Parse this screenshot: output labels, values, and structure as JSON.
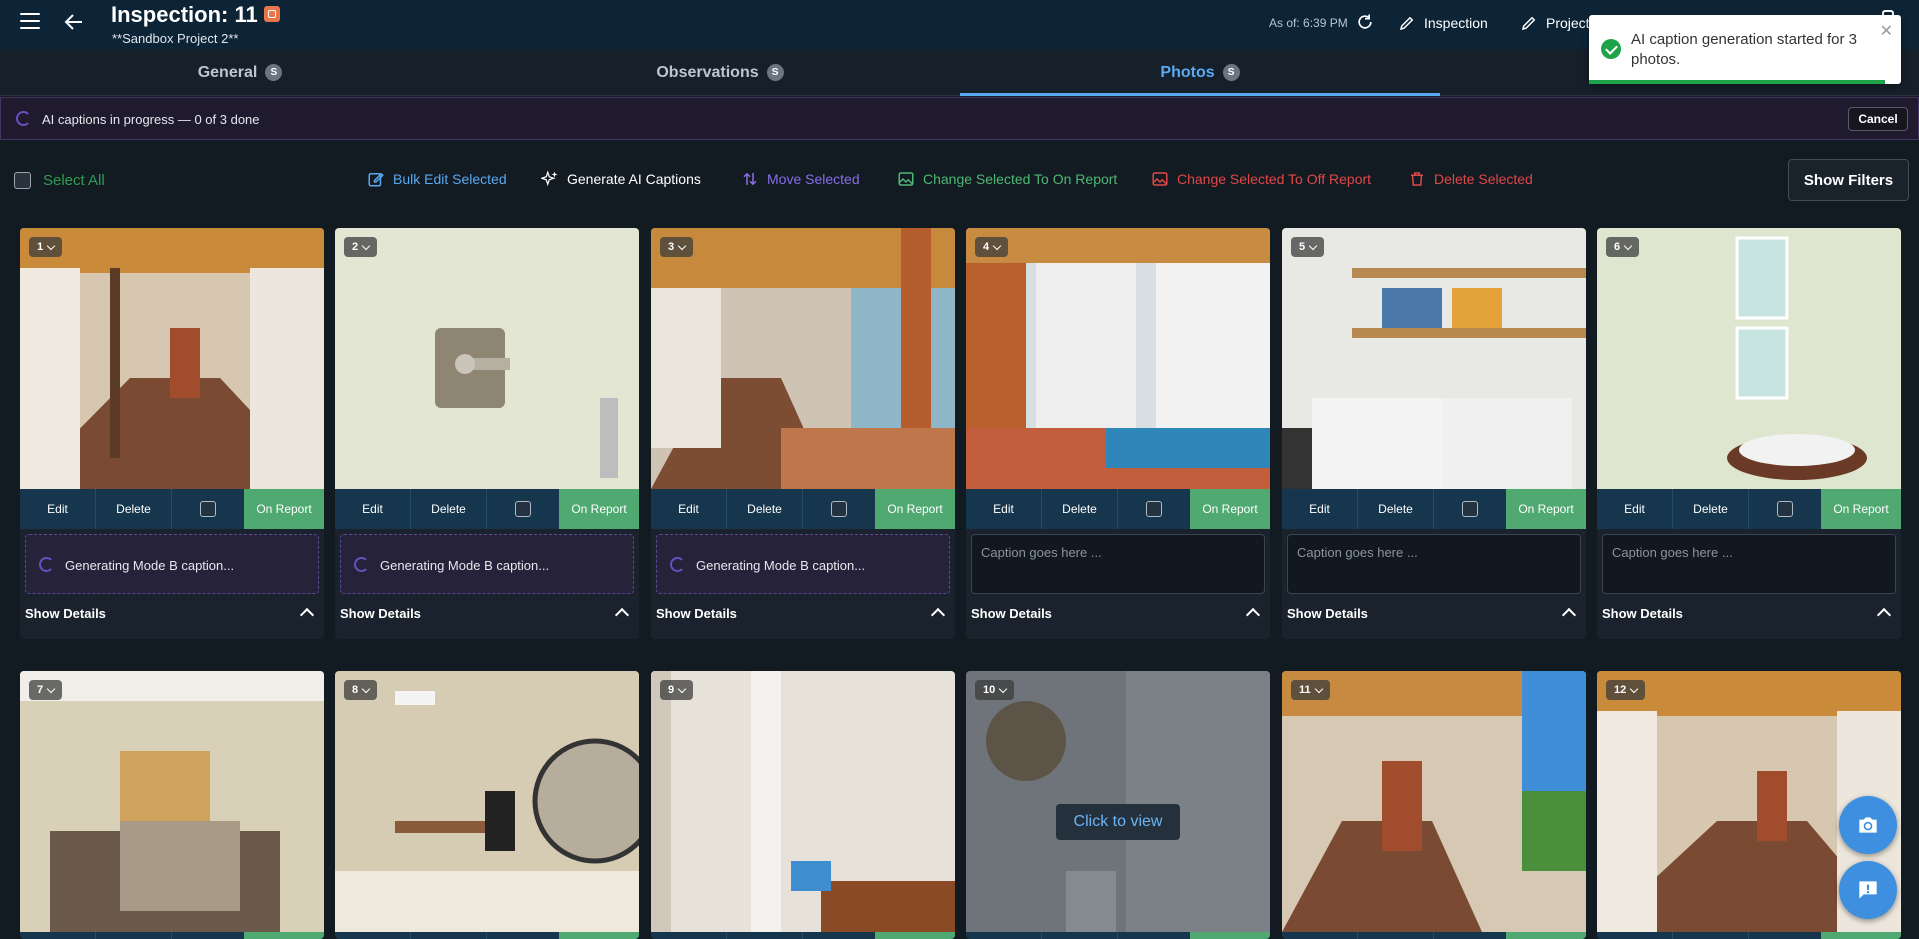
{
  "header": {
    "title": "Inspection: 11",
    "subtitle": "**Sandbox Project 2**",
    "as_of": "As of: 6:39 PM",
    "links": [
      {
        "label": "Inspection"
      },
      {
        "label": "Project"
      }
    ]
  },
  "tabs": [
    {
      "label": "General",
      "count": "S"
    },
    {
      "label": "Observations",
      "count": "S"
    },
    {
      "label": "Photos",
      "count": "S"
    }
  ],
  "ai_status": {
    "text": "AI captions in progress — 0 of 3 done",
    "cancel": "Cancel"
  },
  "toolbar": {
    "select_all": "Select All",
    "bulk_edit": "Bulk Edit Selected",
    "generate": "Generate AI Captions",
    "move": "Move Selected",
    "on_report": "Change Selected To On Report",
    "off_report": "Change Selected To Off Report",
    "delete": "Delete Selected",
    "filters": "Show Filters"
  },
  "colors": {
    "bulk_edit": "#5aa8f0",
    "generate": "#ffffff",
    "move": "#8a6ee8",
    "on_report": "#4fb874",
    "off_report": "#e04848",
    "delete": "#e04848"
  },
  "card_common": {
    "edit": "Edit",
    "delete": "Delete",
    "on_report": "On Report",
    "generating": "Generating Mode B caption...",
    "placeholder": "Caption goes here ...",
    "details": "Show Details"
  },
  "photos": [
    {
      "n": "1",
      "scene": "walkway"
    },
    {
      "n": "2",
      "scene": "wall-fixture"
    },
    {
      "n": "3",
      "scene": "walkway-bed"
    },
    {
      "n": "4",
      "scene": "curtains"
    },
    {
      "n": "5",
      "scene": "laundry"
    },
    {
      "n": "6",
      "scene": "bathroom-window"
    },
    {
      "n": "7",
      "scene": "living-room"
    },
    {
      "n": "8",
      "scene": "office"
    },
    {
      "n": "9",
      "scene": "hallway"
    },
    {
      "n": "10",
      "scene": "shower"
    },
    {
      "n": "11",
      "scene": "walkway-garden"
    },
    {
      "n": "12",
      "scene": "walkway"
    }
  ],
  "click_to_view": "Click to view",
  "toast": {
    "message": "AI caption generation started for 3 photos."
  }
}
